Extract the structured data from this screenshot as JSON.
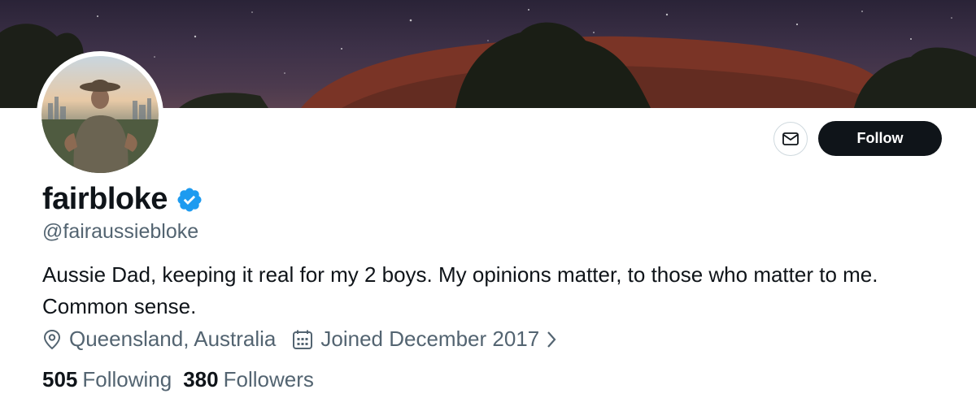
{
  "profile": {
    "display_name": "fairbloke",
    "handle": "@fairaussiebloke",
    "bio": "Aussie Dad, keeping it real for my 2 boys. My opinions matter, to those who matter to me. Common sense.",
    "location": "Queensland, Australia",
    "joined": "Joined December 2017",
    "verified_icon": "verified-badge-icon"
  },
  "actions": {
    "message_icon": "mail-icon",
    "follow_label": "Follow"
  },
  "stats": {
    "following_count": "505",
    "following_label": "Following",
    "followers_count": "380",
    "followers_label": "Followers"
  },
  "colors": {
    "verified_blue": "#1d9bf0",
    "text_primary": "#0f1419",
    "text_secondary": "#536471",
    "follow_button": "#0f1419"
  }
}
